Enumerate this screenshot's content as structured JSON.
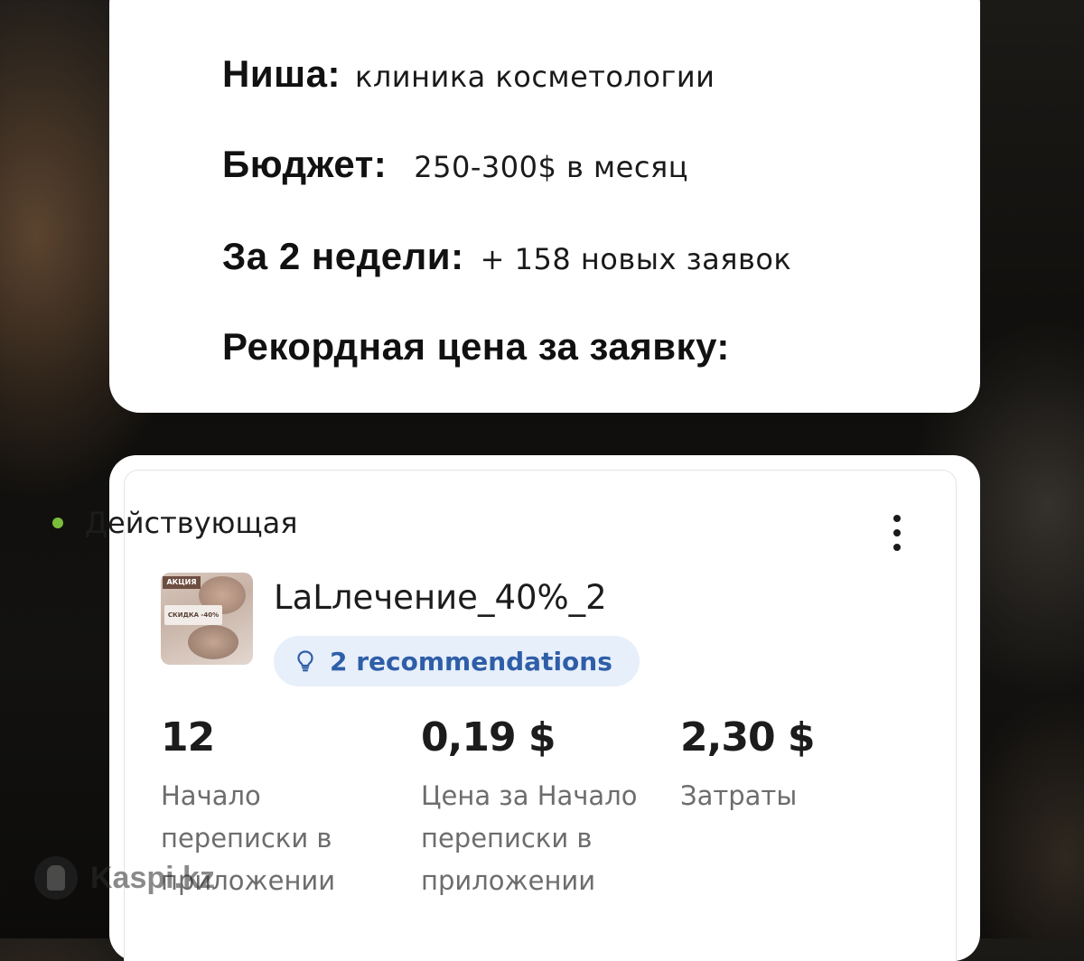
{
  "info": {
    "niche_key": "Ниша:",
    "niche_value": "клиника косметологии",
    "budget_key": "Бюджет:",
    "budget_value": "250-300$ в месяц",
    "period_key": "За 2 недели:",
    "period_value": "+ 158 новых заявок",
    "record_key": "Рекордная цена за заявку:"
  },
  "campaign": {
    "status": "Действующая",
    "status_color": "#7bbd3a",
    "more_icon": "vertical-dots-icon",
    "name": "LaLлечение_40%_2",
    "thumbnail": {
      "tag": "АКЦИЯ",
      "promo": "СКИДКА -40%"
    },
    "recommendations_icon": "lightbulb-icon",
    "recommendations": "2 recommendations",
    "recommendations_color": "#2f5ea8",
    "metrics": [
      {
        "value": "12",
        "label": "Начало переписки в приложении"
      },
      {
        "value": "0,19 $",
        "label": "Цена за Начало переписки в приложении"
      },
      {
        "value": "2,30 $",
        "label": "Затраты"
      }
    ]
  },
  "watermark": {
    "text": "Kaspi.kz"
  }
}
